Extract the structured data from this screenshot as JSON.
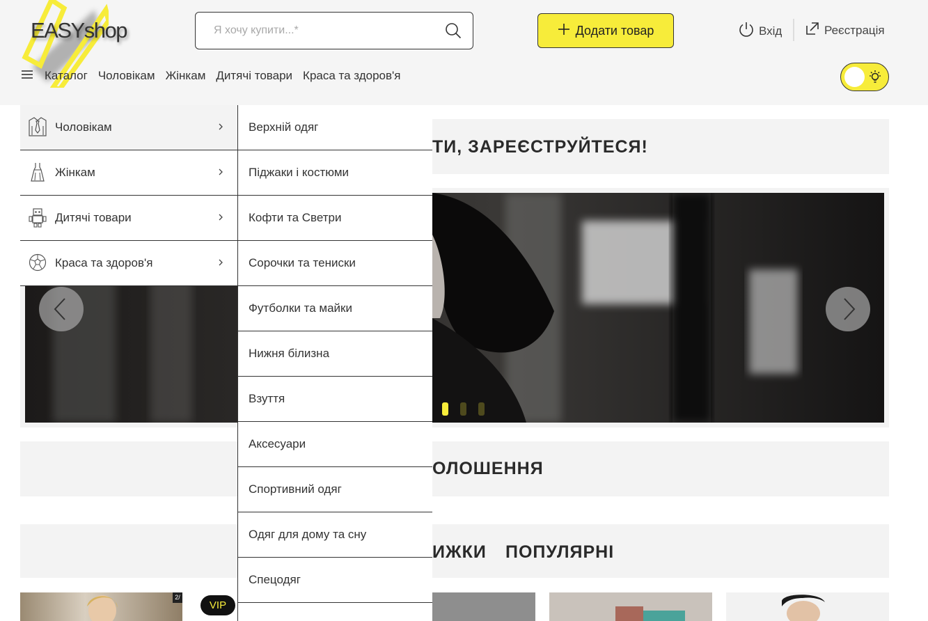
{
  "header": {
    "logo": {
      "easy": "EASY",
      "shop": "shop"
    },
    "search": {
      "placeholder": "Я хочу купити...*"
    },
    "add_product_label": "Додати товар",
    "login_label": "Вхід",
    "register_label": "Реєстрація",
    "nav": {
      "catalog": "Каталог",
      "items": [
        "Чоловікам",
        "Жінкам",
        "Дитячі товари",
        "Краса та здоров'я"
      ]
    },
    "theme_toggle": {
      "state": "light"
    }
  },
  "banners": {
    "register_text": "ТИ, ЗАРЕЄСТРУЙТЕСЯ!",
    "announcements_text": "ОЛОШЕННЯ",
    "tabs": [
      "ИЖКИ",
      "ПОПУЛЯРНІ"
    ]
  },
  "slider": {
    "slide_count": 3,
    "active_index": 0
  },
  "catalog_menu": {
    "categories": [
      {
        "label": "Чоловікам",
        "icon": "shirt-tie-icon"
      },
      {
        "label": "Жінкам",
        "icon": "dress-icon"
      },
      {
        "label": "Дитячі товари",
        "icon": "robot-toy-icon"
      },
      {
        "label": "Краса та здоров'я",
        "icon": "soccer-ball-icon"
      }
    ],
    "subcategories": [
      "Верхній одяг",
      "Піджаки і костюми",
      "Кофти та Светри",
      "Сорочки та тениски",
      "Футболки та майки",
      "Нижня білизна",
      "Взуття",
      "Аксесуари",
      "Спортивний одяг",
      "Одяг для дому та сну",
      "Спецодяг"
    ]
  },
  "products": {
    "vip_label": "VIP",
    "first_card_counter": "2/"
  },
  "colors": {
    "accent": "#f7ec3a",
    "text": "#222222",
    "panel": "#f3f3f3"
  }
}
